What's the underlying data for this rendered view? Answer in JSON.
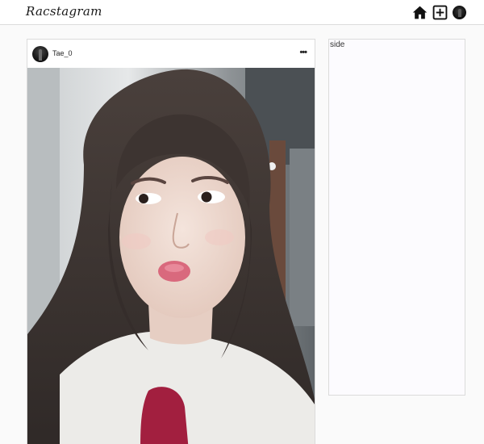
{
  "header": {
    "logo": "Racstagram",
    "icons": [
      "home-icon",
      "new-post-icon",
      "profile-avatar"
    ]
  },
  "post": {
    "username": "Tae_0",
    "more_label": "•••",
    "photo": "portrait-photo"
  },
  "side": {
    "label": "side"
  },
  "colors": {
    "background": "#fafafa",
    "card": "#ffffff",
    "border": "#dbdbdb",
    "side_background": "#fcfbfe"
  }
}
